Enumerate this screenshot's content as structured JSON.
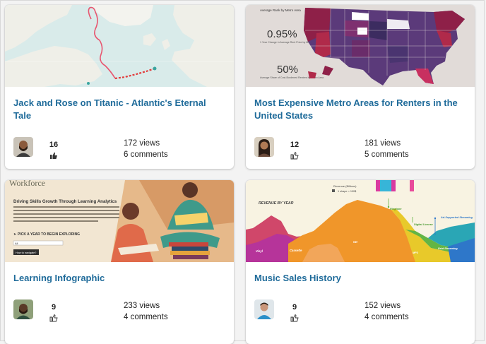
{
  "cards": [
    {
      "title": "Jack and Rose on Titanic - Atlantic's Eternal Tale",
      "likes": "16",
      "views": "172 views",
      "comments": "6 comments",
      "liked": true
    },
    {
      "title": "Most Expensive Metro Areas for Renters in the United States",
      "likes": "12",
      "views": "181 views",
      "comments": "5 comments",
      "liked": false,
      "thumb": {
        "header": "Average Rank by Metro Area",
        "stat1": "0.95%",
        "stat1_label": "1 Year Change in Average Rent Price by Metro Area",
        "stat2": "50%",
        "stat2_label": "Average Share of Cost-Burdened Renters by Metro Area"
      }
    },
    {
      "title": "Learning Infographic",
      "likes": "9",
      "views": "233 views",
      "comments": "4 comments",
      "liked": false,
      "thumb": {
        "brand": "Workforce",
        "heading": "Driving Skills Growth Through Learning Analytics",
        "cta": "PICK A YEAR TO BEGIN EXPLORING",
        "select_value": "All",
        "button": "How to navigate?"
      }
    },
    {
      "title": "Music Sales History",
      "likes": "9",
      "views": "152 views",
      "comments": "4 comments",
      "liked": false,
      "thumb": {
        "top": "Revenue (Billions)",
        "legend": "1 shape = 100$",
        "side": "REVENUE BY YEAR",
        "l_vinyl": "Vinyl",
        "l_cassette": "Cassette",
        "l_cd": "CD",
        "l_ringtone": "Ringtone",
        "l_digital": "Digital License",
        "l_mp3": "MP3",
        "l_adstream": "Ad-Supported Streaming",
        "l_paid": "Paid Streaming"
      }
    }
  ],
  "colors": {
    "title": "#1f6b9a",
    "ocean": "#dfeceb",
    "route": "#e8556f"
  }
}
